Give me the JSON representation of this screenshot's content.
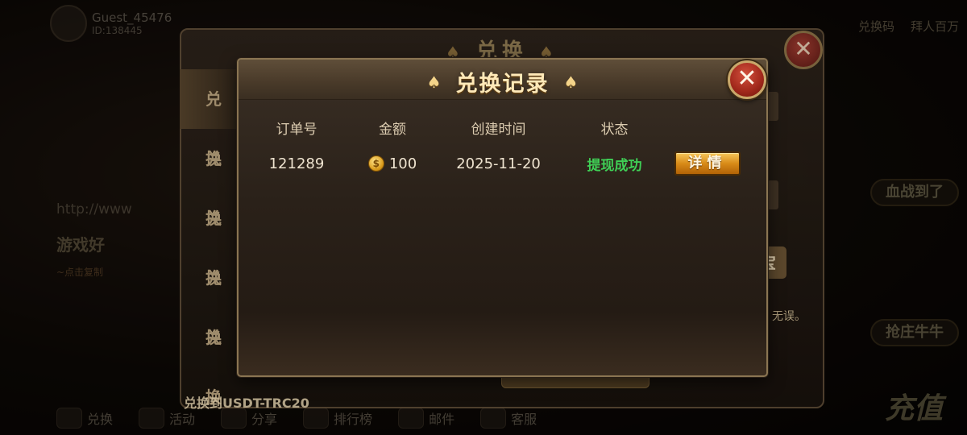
{
  "background": {
    "user": {
      "name": "Guest_45476",
      "id": "ID:138445"
    },
    "top_buttons": [
      "兑换码",
      "拜人百万"
    ],
    "side_pills": [
      "血战到了",
      "抢庄牛牛"
    ],
    "left_url": "http://www",
    "left_slogan": "游戏好",
    "left_small": "~点击复制",
    "bottom_nav": [
      "兑换",
      "活动",
      "分享"
    ],
    "bottom_nav_extra": [
      "排行榜",
      "邮件",
      "客服"
    ],
    "recharge": "充值"
  },
  "parent_panel": {
    "title": "兑换",
    "tabs": [
      "兑换",
      "兑换",
      "兑换",
      "兑换",
      "兑换"
    ],
    "footer": "兑换到USDT-TRC20",
    "right_button": "宝",
    "right_text": "无误。"
  },
  "modal": {
    "title": "兑换记录",
    "close_glyph": "✕",
    "columns": [
      "订单号",
      "金额",
      "创建时间",
      "状态"
    ],
    "rows": [
      {
        "order_no": "121289",
        "amount": "100",
        "created": "2025-11-20",
        "status": "提现成功",
        "detail_label": "详情",
        "coin_glyph": "$"
      }
    ]
  },
  "colors": {
    "status_success": "#3fcf55",
    "detail_button": "#d88b18",
    "close_button": "#a42a1d"
  }
}
